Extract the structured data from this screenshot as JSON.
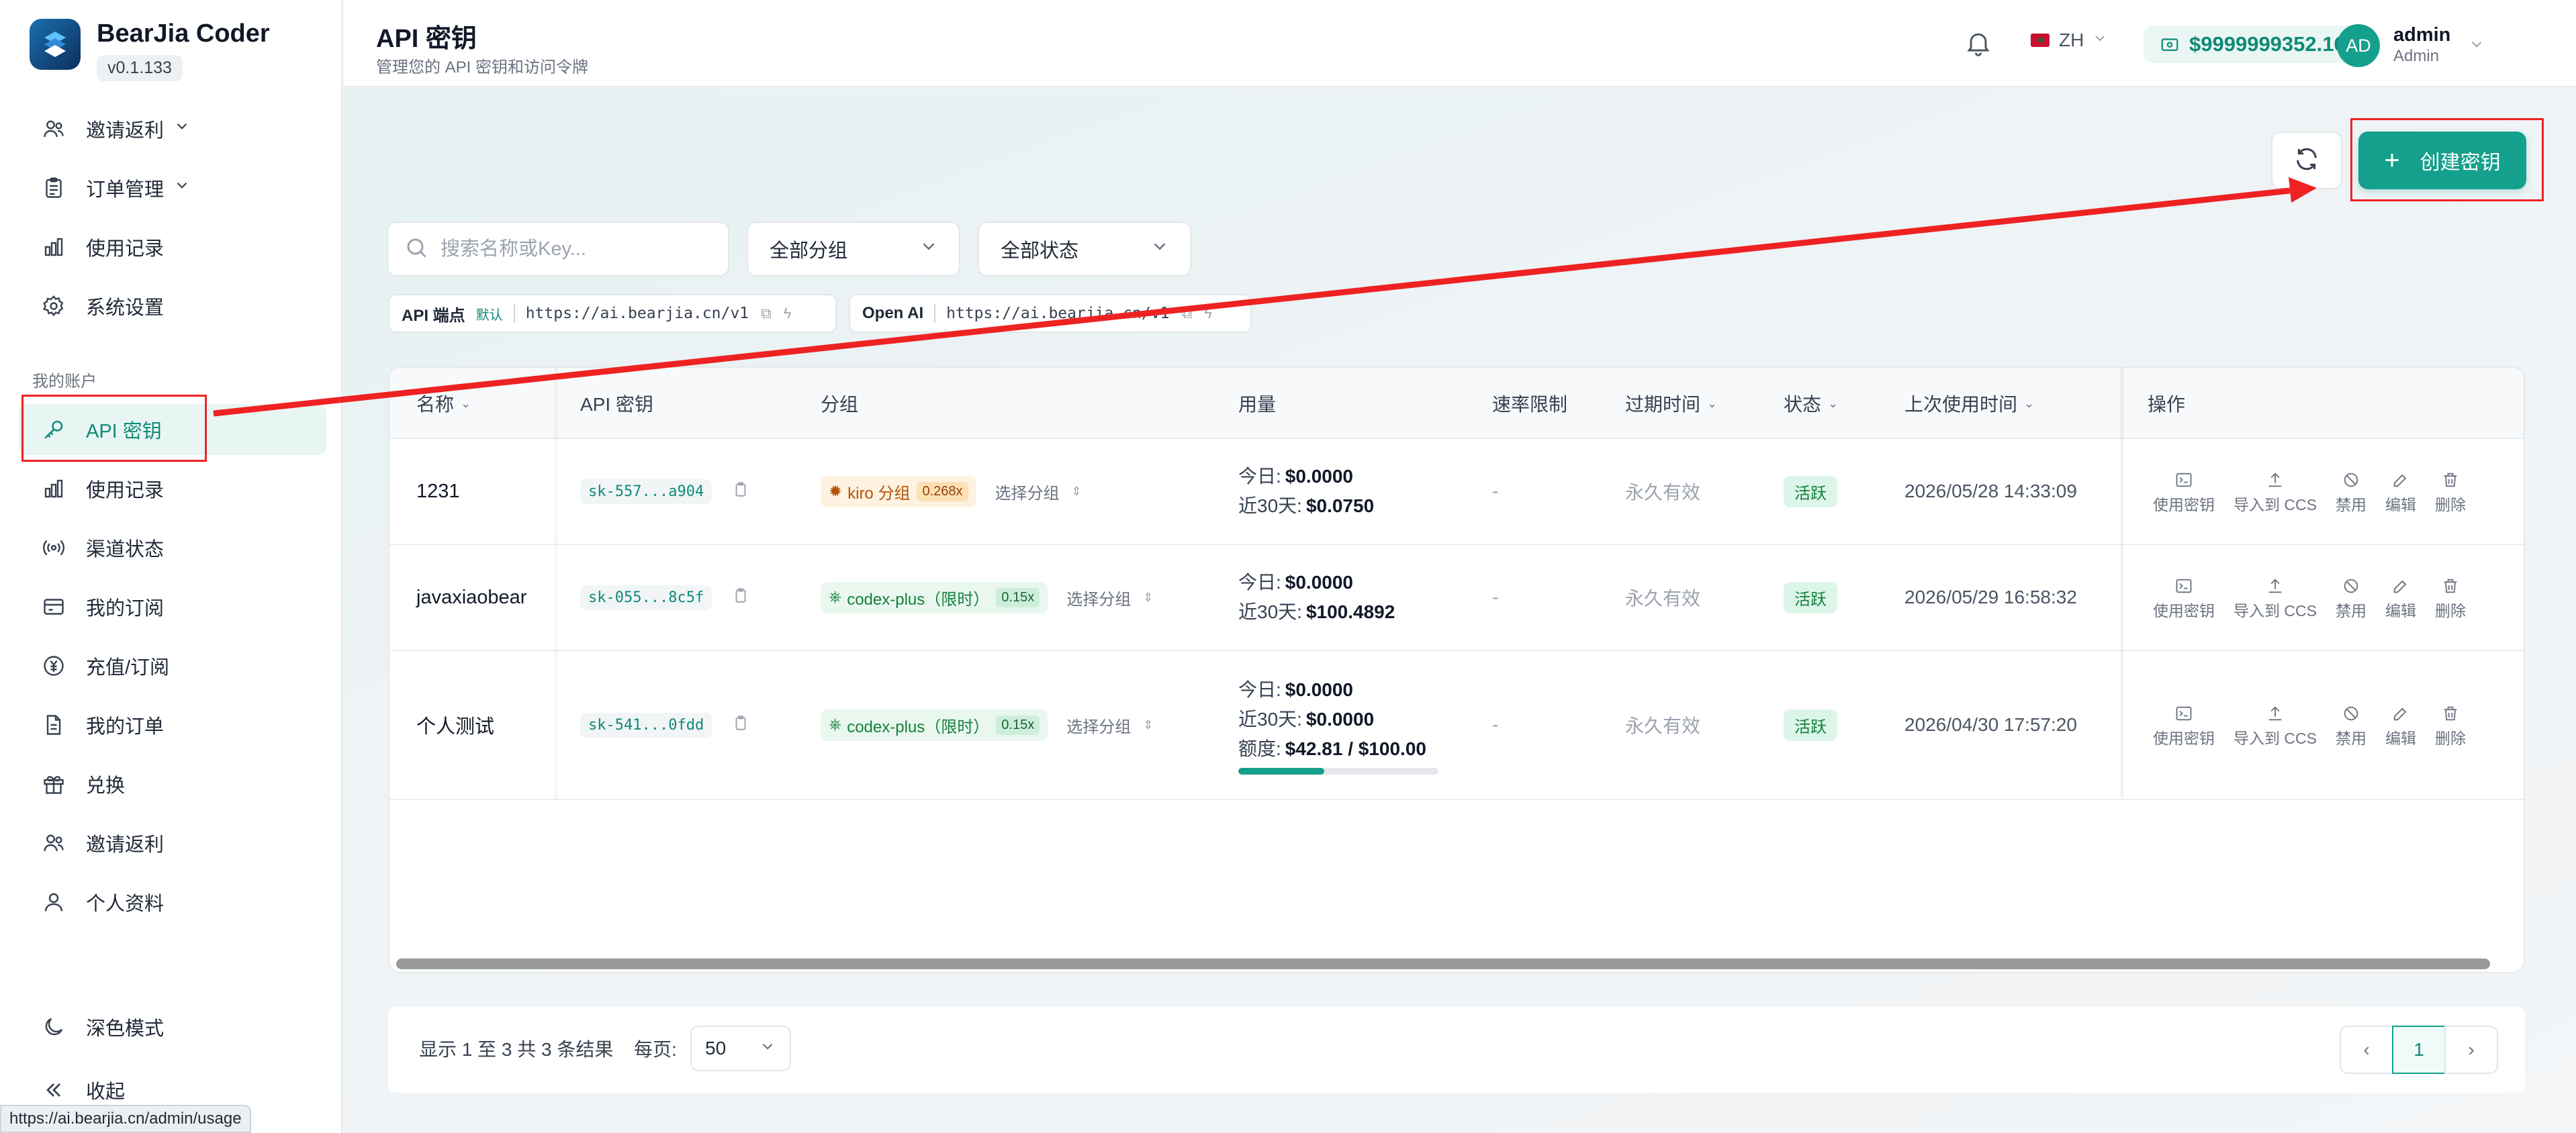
{
  "brand": {
    "title": "BearJia Coder",
    "version": "v0.1.133"
  },
  "sidebar": {
    "top_items": [
      {
        "label": "邀请返利",
        "icon": "users-icon",
        "has_chevron": true
      },
      {
        "label": "订单管理",
        "icon": "clipboard-icon",
        "has_chevron": true
      },
      {
        "label": "使用记录",
        "icon": "bar-chart-icon"
      },
      {
        "label": "系统设置",
        "icon": "gear-icon"
      }
    ],
    "section_label": "我的账户",
    "account_items": [
      {
        "label": "API 密钥",
        "icon": "key-icon",
        "active": true
      },
      {
        "label": "使用记录",
        "icon": "bar-chart-icon"
      },
      {
        "label": "渠道状态",
        "icon": "radio-icon"
      },
      {
        "label": "我的订阅",
        "icon": "credit-card-icon"
      },
      {
        "label": "充值/订阅",
        "icon": "currency-icon"
      },
      {
        "label": "我的订单",
        "icon": "document-icon"
      },
      {
        "label": "兑换",
        "icon": "gift-icon"
      },
      {
        "label": "邀请返利",
        "icon": "users-icon"
      },
      {
        "label": "个人资料",
        "icon": "user-icon"
      }
    ],
    "bottom_items": [
      {
        "label": "深色模式",
        "icon": "moon-icon"
      },
      {
        "label": "收起",
        "icon": "collapse-icon"
      }
    ]
  },
  "header": {
    "title": "API 密钥",
    "subtitle": "管理您的 API 密钥和访问令牌",
    "lang": "ZH",
    "balance": "$9999999352.16",
    "user": {
      "initials": "AD",
      "name": "admin",
      "role": "Admin"
    }
  },
  "toolbar": {
    "create_label": "创建密钥"
  },
  "filters": {
    "search_placeholder": "搜索名称或Key...",
    "group_select": "全部分组",
    "status_select": "全部状态"
  },
  "endpoints": [
    {
      "label": "API 端点",
      "default": "默认",
      "url": "https://ai.bearjia.cn/v1"
    },
    {
      "label": "Open AI",
      "url": "https://ai.bearjia.cn/v1"
    }
  ],
  "table": {
    "headers": {
      "name": "名称",
      "key": "API 密钥",
      "group": "分组",
      "usage": "用量",
      "rate_limit": "速率限制",
      "expires": "过期时间",
      "status": "状态",
      "last_used": "上次使用时间",
      "actions": "操作"
    },
    "action_labels": [
      "使用密钥",
      "导入到 CCS",
      "禁用",
      "编辑",
      "删除"
    ],
    "select_group_label": "选择分组",
    "today_label": "今日:",
    "thirty_label": "近30天:",
    "quota_label": "额度:",
    "rows": [
      {
        "name": "1231",
        "key": "sk-557...a904",
        "group": "kiro 分组",
        "group_type": "kiro",
        "rate": "0.268x",
        "today": "$0.0000",
        "thirty": "$0.0750",
        "rate_limit": "-",
        "expires": "永久有效",
        "status": "活跃",
        "last_used": "2026/05/28 14:33:09"
      },
      {
        "name": "javaxiaobear",
        "key": "sk-055...8c5f",
        "group": "codex-plus（限时）",
        "group_type": "codex",
        "rate": "0.15x",
        "today": "$0.0000",
        "thirty": "$100.4892",
        "rate_limit": "-",
        "expires": "永久有效",
        "status": "活跃",
        "last_used": "2026/05/29 16:58:32"
      },
      {
        "name": "个人测试",
        "key": "sk-541...0fdd",
        "group": "codex-plus（限时）",
        "group_type": "codex",
        "rate": "0.15x",
        "today": "$0.0000",
        "thirty": "$0.0000",
        "quota": "$42.81 / $100.00",
        "quota_fraction": 0.4281,
        "rate_limit": "-",
        "expires": "永久有效",
        "status": "活跃",
        "last_used": "2026/04/30 17:57:20"
      }
    ]
  },
  "pagination": {
    "summary": "显示 1 至 3 共 3 条结果",
    "per_page_label": "每页:",
    "per_page": "50",
    "current_page": "1"
  },
  "browser_status_url": "https://ai.bearjia.cn/admin/usage",
  "colors": {
    "accent": "#14a08c",
    "annotation": "#ee2222"
  }
}
